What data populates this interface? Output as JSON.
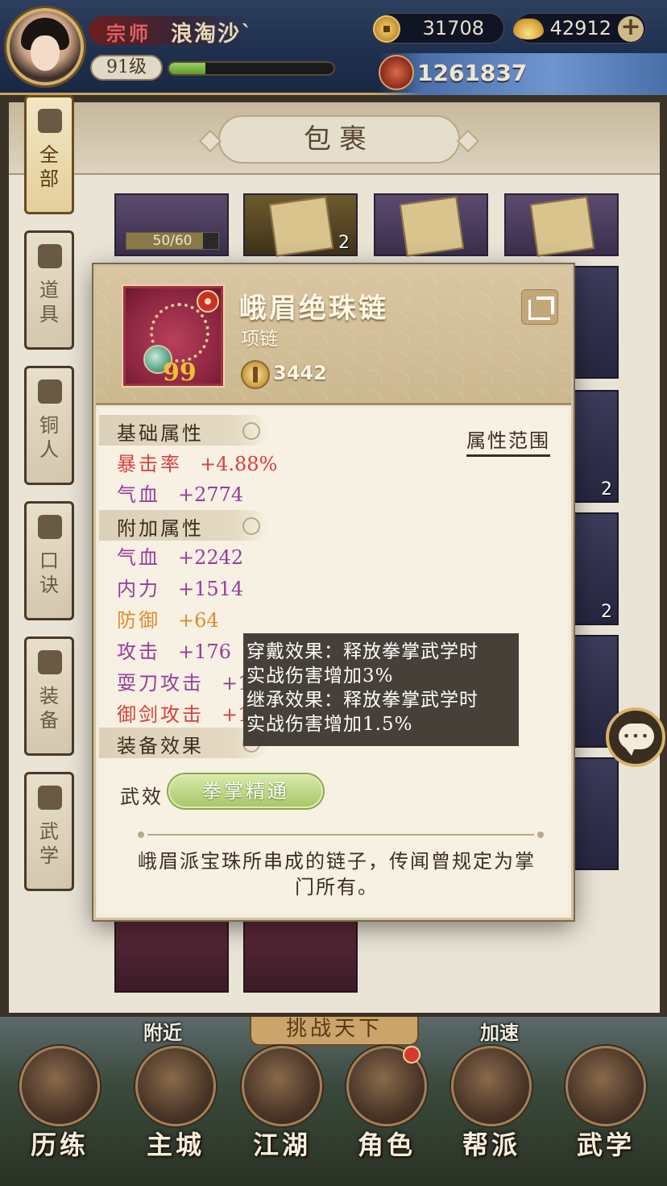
{
  "player": {
    "title": "宗师",
    "name": "浪淘沙`",
    "level": "91级",
    "exp_fraction": 0.22,
    "coins": "31708",
    "ingots": "42912",
    "power": "1261837"
  },
  "bag": {
    "title": "包裹",
    "tabs": [
      {
        "label": "全\n部",
        "icon": "fan-icon"
      },
      {
        "label": "道\n具",
        "icon": "pouch-icon"
      },
      {
        "label": "铜\n人",
        "icon": "bronze-man-icon"
      },
      {
        "label": "口\n诀",
        "icon": "scroll-icon"
      },
      {
        "label": "装\n备",
        "icon": "armor-icon"
      },
      {
        "label": "武\n学",
        "icon": "book-icon"
      }
    ],
    "grid": {
      "durability": "50/60",
      "counts": [
        "2",
        "2",
        "2"
      ]
    }
  },
  "item": {
    "name": "峨眉绝珠链",
    "type": "项链",
    "power": "3442",
    "quality_mark": "99",
    "basic_section": "基础属性",
    "range_link": "属性范围",
    "basic_attrs": [
      {
        "name": "暴击率",
        "value": "+4.88%",
        "color": "#d8403a"
      },
      {
        "name": "气血",
        "value": "+2774",
        "color": "#9a3c9a"
      }
    ],
    "extra_section": "附加属性",
    "extra_attrs": [
      {
        "name": "气血",
        "value": "+2242",
        "color": "#9a3c9a"
      },
      {
        "name": "内力",
        "value": "+1514",
        "color": "#9a3c9a"
      },
      {
        "name": "防御",
        "value": "+64",
        "color": "#e08a30"
      },
      {
        "name": "攻击",
        "value": "+176",
        "color": "#9a3c9a"
      },
      {
        "name": "耍刀攻击",
        "value": "+1",
        "color": "#9a3c9a"
      },
      {
        "name": "御剑攻击",
        "value": "+1",
        "color": "#d8403a"
      }
    ],
    "effect_section": "装备效果",
    "effect_label": "武效",
    "effect_name": "拳掌精通",
    "description": "峨眉派宝珠所串成的链子，传闻曾规定为掌门所有。"
  },
  "tooltip": {
    "lines": [
      "穿戴效果：释放拳掌武学时",
      "实战伤害增加3%",
      "继承效果：释放拳掌武学时",
      "实战伤害增加1.5%"
    ]
  },
  "bottom_nav": {
    "challenge": "挑战天下",
    "nearby": "附近",
    "speedup": "加速",
    "items": [
      {
        "label": "历练",
        "icon": "training-icon"
      },
      {
        "label": "主城",
        "icon": "city-gate-icon"
      },
      {
        "label": "江湖",
        "icon": "jianghu-icon"
      },
      {
        "label": "角色",
        "icon": "character-icon"
      },
      {
        "label": "帮派",
        "icon": "guild-icon"
      },
      {
        "label": "武学",
        "icon": "martial-scroll-icon"
      }
    ]
  },
  "colors": {
    "crit_red": "#d8403a",
    "attr_purple": "#9a3c9a",
    "attr_orange": "#e08a30",
    "effect_green": "#a8c86a"
  }
}
